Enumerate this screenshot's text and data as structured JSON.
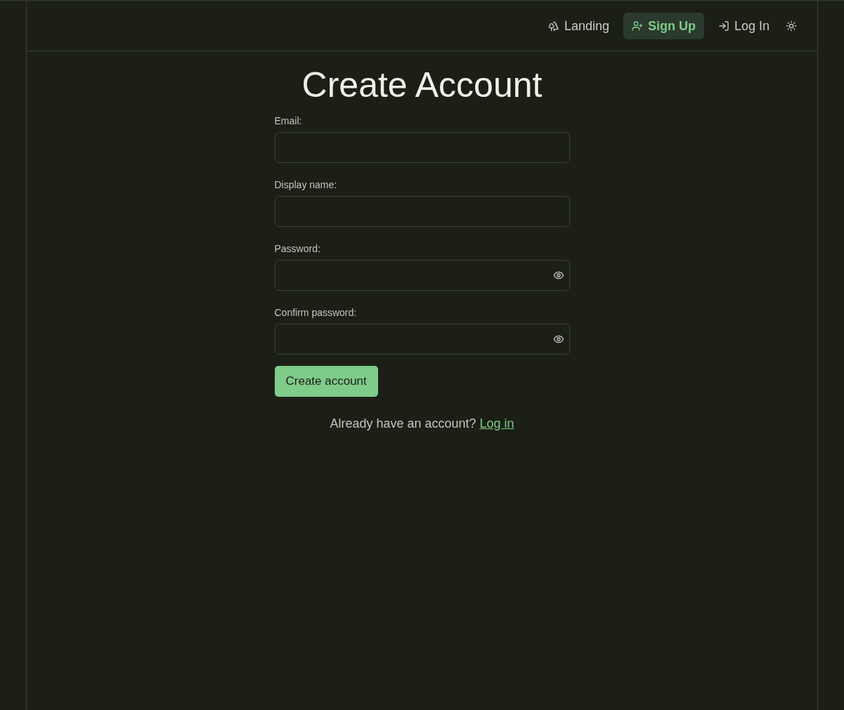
{
  "nav": {
    "items": [
      {
        "label": "Landing",
        "kind": "landing",
        "selected": false
      },
      {
        "label": "Sign Up",
        "kind": "signup",
        "selected": true
      },
      {
        "label": "Log In",
        "kind": "login",
        "selected": false
      }
    ]
  },
  "form": {
    "title": "Create Account",
    "fields": [
      {
        "label": "Email:",
        "kind": "text"
      },
      {
        "label": "Display name:",
        "kind": "text"
      },
      {
        "label": "Password:",
        "kind": "password"
      },
      {
        "label": "Confirm password:",
        "kind": "password"
      }
    ],
    "submit": "Create account"
  },
  "footer": {
    "text": "Already have an account?",
    "link": "Log in"
  }
}
